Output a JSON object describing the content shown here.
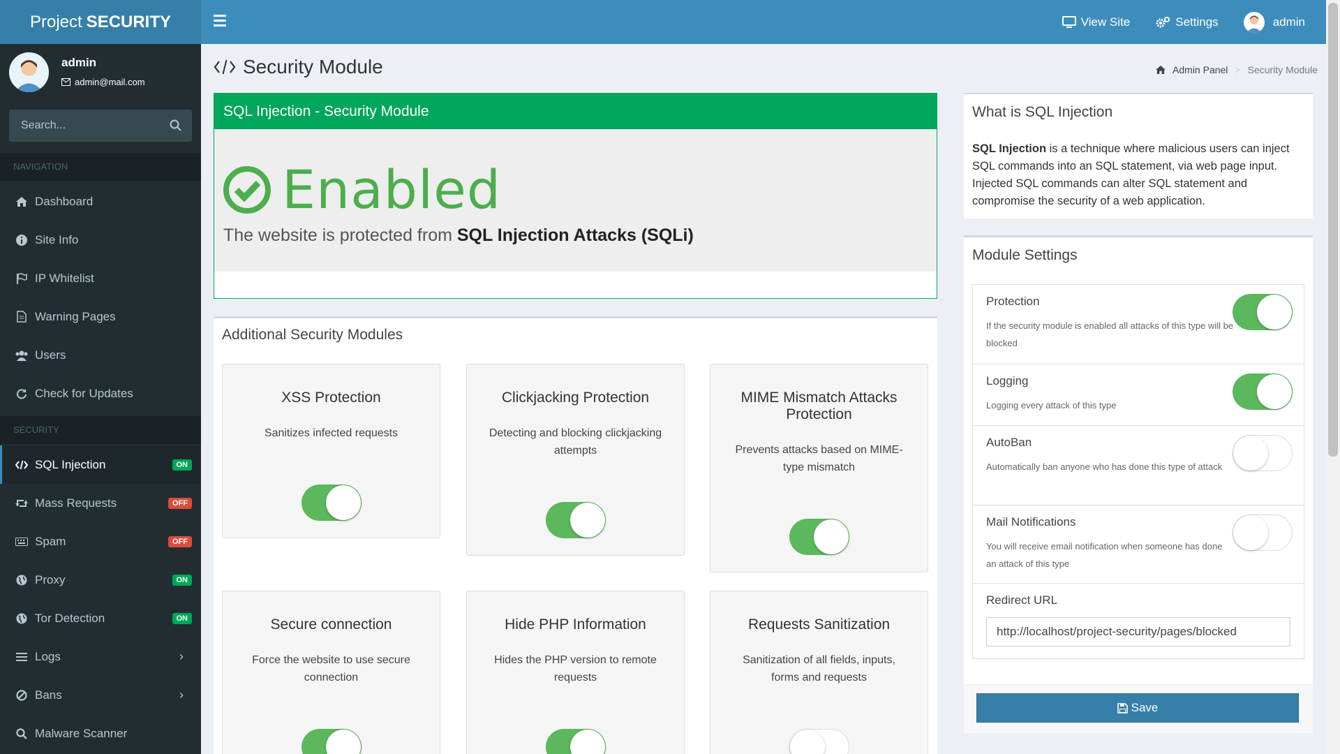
{
  "brand": {
    "prefix": "Project",
    "bold": "SECURITY"
  },
  "topnav": {
    "view_site": "View Site",
    "settings": "Settings",
    "user": "admin"
  },
  "user": {
    "name": "admin",
    "email": "admin@mail.com"
  },
  "search": {
    "placeholder": "Search..."
  },
  "sidebar": {
    "nav_header": "NAVIGATION",
    "security_header": "SECURITY",
    "nav_items": [
      {
        "label": "Dashboard",
        "icon": "home-icon"
      },
      {
        "label": "Site Info",
        "icon": "info-icon"
      },
      {
        "label": "IP Whitelist",
        "icon": "flag-icon"
      },
      {
        "label": "Warning Pages",
        "icon": "document-icon"
      },
      {
        "label": "Users",
        "icon": "users-icon"
      },
      {
        "label": "Check for Updates",
        "icon": "refresh-icon"
      }
    ],
    "security_items": [
      {
        "label": "SQL Injection",
        "badge": "ON",
        "active": true
      },
      {
        "label": "Mass Requests",
        "badge": "OFF"
      },
      {
        "label": "Spam",
        "badge": "OFF"
      },
      {
        "label": "Proxy",
        "badge": "ON"
      },
      {
        "label": "Tor Detection",
        "badge": "ON"
      },
      {
        "label": "Logs",
        "chevron": "›"
      },
      {
        "label": "Bans",
        "chevron": "›"
      },
      {
        "label": "Malware Scanner"
      }
    ]
  },
  "page": {
    "title": "Security Module"
  },
  "breadcrumb": {
    "home": "Admin Panel",
    "current": "Security Module"
  },
  "status": {
    "header": "SQL Injection - Security Module",
    "state": "Enabled",
    "line_prefix": "The website is protected from",
    "line_bold": "SQL Injection Attacks (SQLi)"
  },
  "additional": {
    "title": "Additional Security Modules",
    "cards": [
      {
        "title": "XSS Protection",
        "desc": "Sanitizes infected requests",
        "enabled": true
      },
      {
        "title": "Clickjacking Protection",
        "desc": "Detecting and blocking clickjacking attempts",
        "enabled": true
      },
      {
        "title": "MIME Mismatch Attacks Protection",
        "desc": "Prevents attacks based on MIME-type mismatch",
        "enabled": true
      },
      {
        "title": "Secure connection",
        "desc": "Force the website to use secure connection",
        "enabled": true
      },
      {
        "title": "Hide PHP Information",
        "desc": "Hides the PHP version to remote requests",
        "enabled": true
      },
      {
        "title": "Requests Sanitization",
        "desc": "Sanitization of all fields, inputs, forms and requests",
        "enabled": false
      }
    ]
  },
  "info": {
    "title": "What is SQL Injection",
    "bold": "SQL Injection",
    "text": "is a technique where malicious users can inject SQL commands into an SQL statement, via web page input. Injected SQL commands can alter SQL statement and compromise the security of a web application."
  },
  "module_settings": {
    "title": "Module Settings",
    "items": [
      {
        "title": "Protection",
        "desc": "If the security module is enabled all attacks of this type will be blocked",
        "enabled": true
      },
      {
        "title": "Logging",
        "desc": "Logging every attack of this type",
        "enabled": true
      },
      {
        "title": "AutoBan",
        "desc": "Automatically ban anyone who has done this type of attack",
        "enabled": false
      },
      {
        "title": "Mail Notifications",
        "desc": "You will receive email notification when someone has done an attack of this type",
        "enabled": false
      }
    ],
    "redirect_label": "Redirect URL",
    "redirect_value": "http://localhost/project-security/pages/blocked",
    "save": "Save"
  },
  "colors": {
    "header": "#3c8dbc",
    "sidebar": "#222d32",
    "success": "#00a65a",
    "danger": "#dd4b39"
  }
}
